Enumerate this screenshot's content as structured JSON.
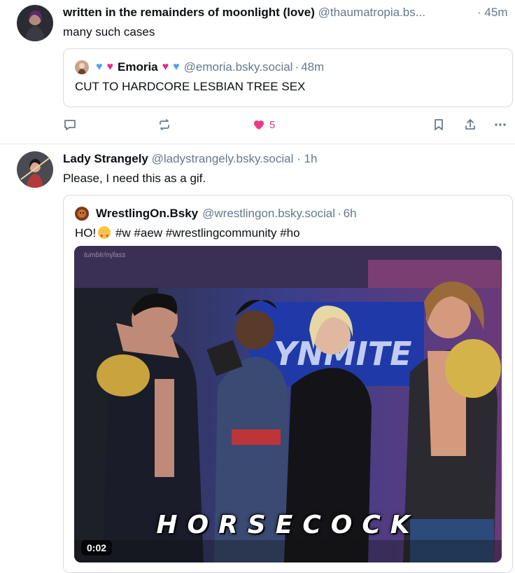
{
  "post1": {
    "author_name": "written in the remainders of moonlight (love)",
    "handle": "@thaumatropia.bs...",
    "separator": "·",
    "time": "45m",
    "text": "many such cases",
    "quote": {
      "name": "Emoria",
      "handle": "@emoria.bsky.social",
      "separator": "·",
      "time": "48m",
      "text": "CUT TO HARDCORE LESBIAN TREE SEX"
    },
    "actions": {
      "like_count": "5"
    }
  },
  "post2": {
    "author_name": "Lady Strangely",
    "handle": "@ladystrangely.bsky.social",
    "separator": "·",
    "time": "1h",
    "text": "Please, I need this as a gif.",
    "quote": {
      "name": "WrestlingOn.Bsky",
      "handle": "@wrestlingon.bsky.social",
      "separator": "·",
      "time": "6h",
      "text_prefix": "HO!",
      "text_suffix": " #w #aew #wrestlingcommunity #ho",
      "media": {
        "watermark": "tumblr/mjfass",
        "caption": "HORSECOCK",
        "duration": "0:02"
      }
    }
  },
  "colors": {
    "like_pink": "#ea3b86",
    "handle_gray": "#66788a",
    "divider": "#e3e8ee"
  },
  "icons": [
    "reply-icon",
    "repost-icon",
    "heart-icon",
    "bookmark-icon",
    "share-icon",
    "more-icon"
  ]
}
